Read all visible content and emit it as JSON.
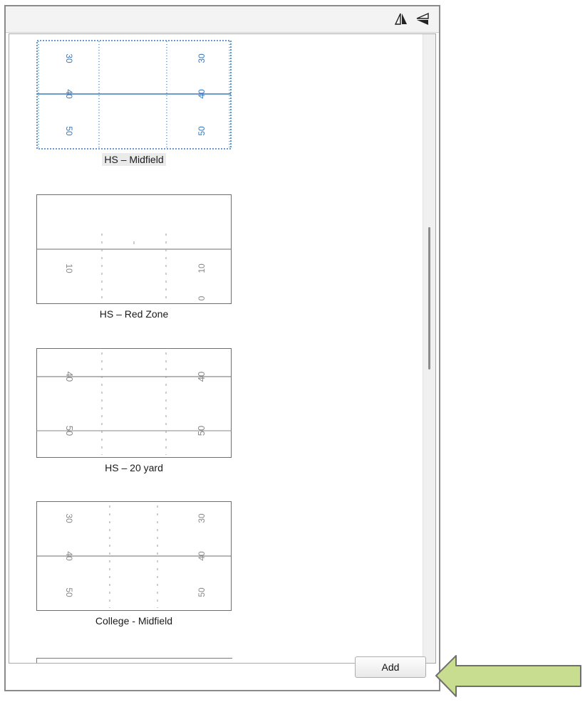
{
  "toolbar": {
    "buttons": [
      {
        "icon": "flip-horizontal-icon"
      },
      {
        "icon": "flip-vertical-icon"
      }
    ]
  },
  "formations": [
    {
      "label": "HS – Midfield",
      "selected": true,
      "numbers": [
        "30",
        "40",
        "50"
      ]
    },
    {
      "label": "HS – Red Zone",
      "selected": false,
      "numbers": [
        "10",
        "0"
      ]
    },
    {
      "label": "HS – 20 yard",
      "selected": false,
      "numbers": [
        "40",
        "50"
      ]
    },
    {
      "label": "College - Midfield",
      "selected": false,
      "numbers": [
        "30",
        "40",
        "50"
      ]
    }
  ],
  "footer": {
    "add_label": "Add"
  },
  "colors": {
    "selected_line": "#3b78b8",
    "field_line": "#6e6e6e",
    "hint_arrow_fill": "#c8dd8f",
    "hint_arrow_stroke": "#6f6f6f"
  }
}
